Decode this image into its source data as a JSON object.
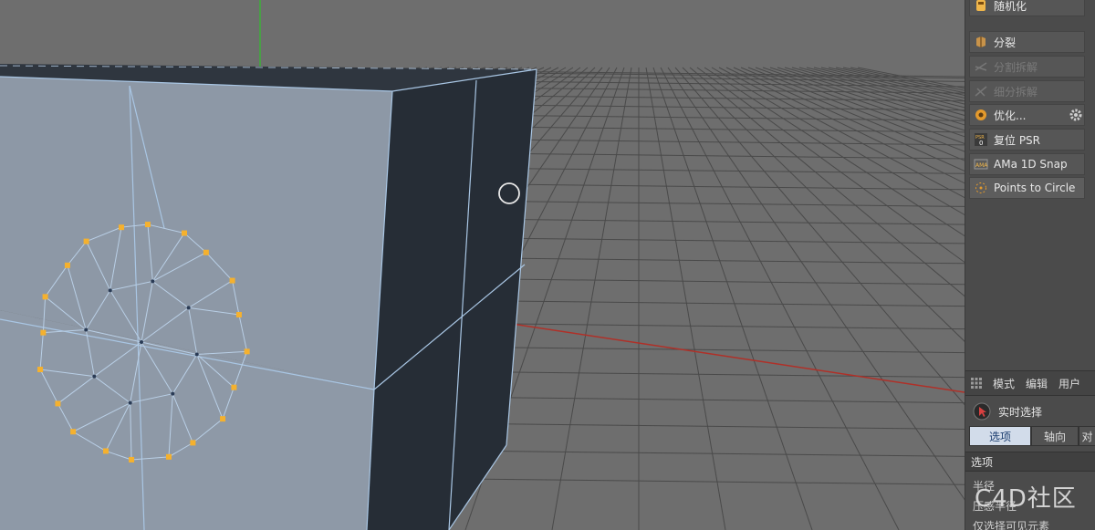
{
  "viewport": {
    "colors": {
      "background": "#6e6e6e",
      "grid": "#4a4a4a",
      "cube_front": "#8d98a6",
      "cube_side": "#262d36",
      "edge": "#a9c6e4",
      "point": "#f5b12e",
      "x_axis": "#b03028",
      "y_axis": "#3fae3a"
    }
  },
  "commands": [
    {
      "label": "随机化",
      "icon": "randomize-icon",
      "state": "normal"
    },
    {
      "label": "分裂",
      "icon": "split-icon",
      "state": "normal"
    },
    {
      "label": "分割拆解",
      "icon": "disconnect-icon",
      "state": "disabled"
    },
    {
      "label": "细分拆解",
      "icon": "subdivide-icon",
      "state": "disabled"
    },
    {
      "label": "优化...",
      "icon": "optimize-icon",
      "state": "normal",
      "has_settings": true
    },
    {
      "label": "复位 PSR",
      "icon": "reset-psr-icon",
      "state": "normal"
    },
    {
      "label": "AMa 1D Snap",
      "icon": "snap-icon",
      "state": "normal"
    },
    {
      "label": "Points to Circle",
      "icon": "points-circle-icon",
      "state": "highlight"
    }
  ],
  "attribute_manager": {
    "menu": [
      "模式",
      "编辑",
      "用户"
    ],
    "tool_title": "实时选择",
    "tabs": [
      {
        "label": "选项",
        "active": true
      },
      {
        "label": "轴向",
        "active": false
      },
      {
        "label": "对",
        "active": false
      }
    ],
    "section": "选项",
    "props": [
      "半径",
      "压感半径",
      "仅选择可见元素"
    ]
  },
  "watermark": "C4D社区"
}
